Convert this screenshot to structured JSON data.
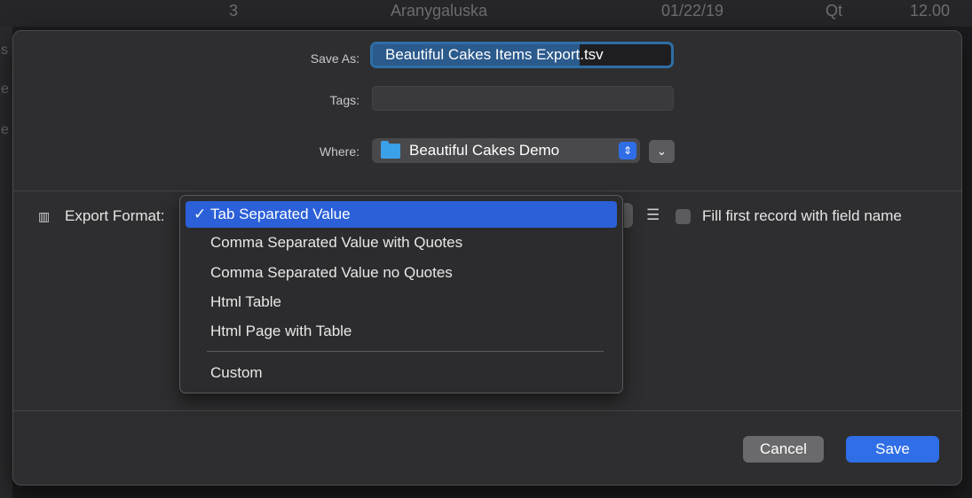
{
  "background": {
    "row": {
      "index": "3",
      "name": "Aranygaluska",
      "date": "01/22/19",
      "unit": "Qt",
      "amount": "12.00"
    },
    "edge_letters": [
      "s",
      "e",
      "e"
    ]
  },
  "dialog": {
    "save_as_label": "Save As:",
    "filename_selected": "Beautiful Cakes Items Export",
    "filename_extension": ".tsv",
    "tags_label": "Tags:",
    "tags_value": "",
    "where_label": "Where:",
    "where_value": "Beautiful Cakes Demo",
    "export_format_label": "Export Format:",
    "fill_first_record_label": "Fill first record with field name",
    "fill_first_record_checked": false,
    "cancel_label": "Cancel",
    "save_label": "Save"
  },
  "export_menu": {
    "selected": "Tab Separated Value",
    "check_mark": "✓",
    "options": [
      "Tab Separated Value",
      "Comma Separated Value with Quotes",
      "Comma Separated Value no Quotes",
      "Html Table",
      "Html Page with Table"
    ],
    "custom_option": "Custom"
  },
  "icons": {
    "columns": "columns-icon",
    "folder": "folder-icon",
    "stepper": "up-down-chevron-icon",
    "expand": "chevron-down-icon",
    "list": "list-icon"
  },
  "colors": {
    "accent": "#2f6ee6",
    "menu_highlight": "#2b60d8",
    "folder": "#3aa0e8"
  }
}
